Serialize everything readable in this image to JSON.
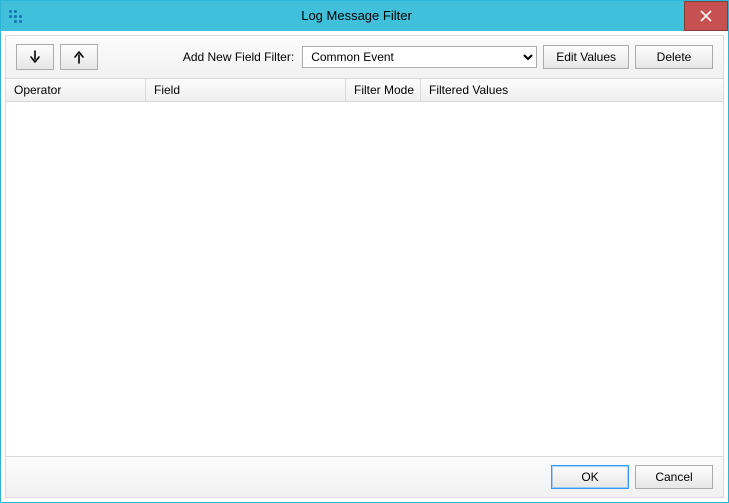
{
  "window": {
    "title": "Log Message Filter"
  },
  "toolbar": {
    "add_new_label": "Add New Field Filter:",
    "filter_select_value": "Common Event",
    "edit_values_label": "Edit Values",
    "delete_label": "Delete"
  },
  "grid": {
    "columns": {
      "operator": "Operator",
      "field": "Field",
      "filter_mode": "Filter Mode",
      "filtered_values": "Filtered Values"
    },
    "rows": []
  },
  "footer": {
    "ok_label": "OK",
    "cancel_label": "Cancel"
  }
}
